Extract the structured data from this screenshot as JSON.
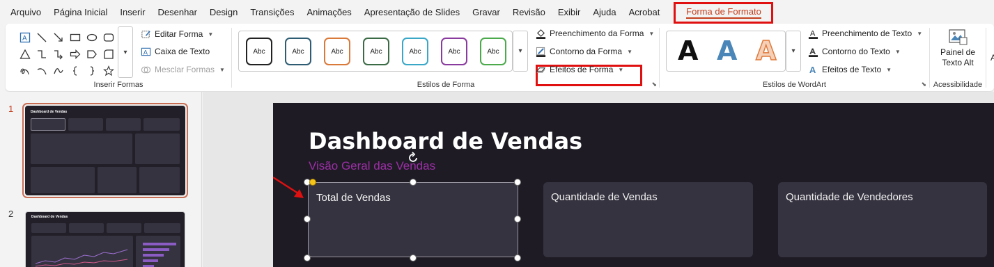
{
  "menu": {
    "tabs": [
      "Arquivo",
      "Página Inicial",
      "Inserir",
      "Desenhar",
      "Design",
      "Transições",
      "Animações",
      "Apresentação de Slides",
      "Gravar",
      "Revisão",
      "Exibir",
      "Ajuda",
      "Acrobat"
    ],
    "active_tab": "Forma de Formato"
  },
  "ribbon": {
    "insert_shapes": {
      "label": "Inserir Formas",
      "edit_shape": "Editar Forma",
      "text_box": "Caixa de Texto",
      "merge_shapes": "Mesclar Formas"
    },
    "shape_styles": {
      "label": "Estilos de Forma",
      "style_samples": [
        "Abc",
        "Abc",
        "Abc",
        "Abc",
        "Abc",
        "Abc",
        "Abc"
      ],
      "style_colors": [
        "#222222",
        "#2e5d73",
        "#d9793a",
        "#3a6b45",
        "#3aa7c7",
        "#8a3b9e",
        "#4caa4c"
      ],
      "fill": "Preenchimento da Forma",
      "outline": "Contorno da Forma",
      "effects": "Efeitos de Forma"
    },
    "wordart_styles": {
      "label": "Estilos de WordArt",
      "samples": [
        "A",
        "A",
        "A"
      ],
      "text_fill": "Preenchimento de Texto",
      "text_outline": "Contorno do Texto",
      "text_effects": "Efeitos de Texto"
    },
    "accessibility": {
      "label": "Acessibilidade",
      "alt_text_line1": "Painel de",
      "alt_text_line2": "Texto Alt",
      "extra": "A"
    }
  },
  "thumbnails": {
    "slides": [
      {
        "number": "1",
        "title": "Dashboard de Vendas"
      },
      {
        "number": "2",
        "title": "Dashboard de Vendas"
      }
    ]
  },
  "slide": {
    "title": "Dashboard de Vendas",
    "subtitle": "Visão Geral das Vendas",
    "cards": [
      "Total de Vendas",
      "Quantidade de Vendas",
      "Quantidade de Vendedores"
    ]
  },
  "colors": {
    "accent": "#c43e1c",
    "highlight": "#e01010",
    "slide_bg": "#1e1b24",
    "card_bg": "#363340",
    "subtitle": "#9c2fa6"
  }
}
